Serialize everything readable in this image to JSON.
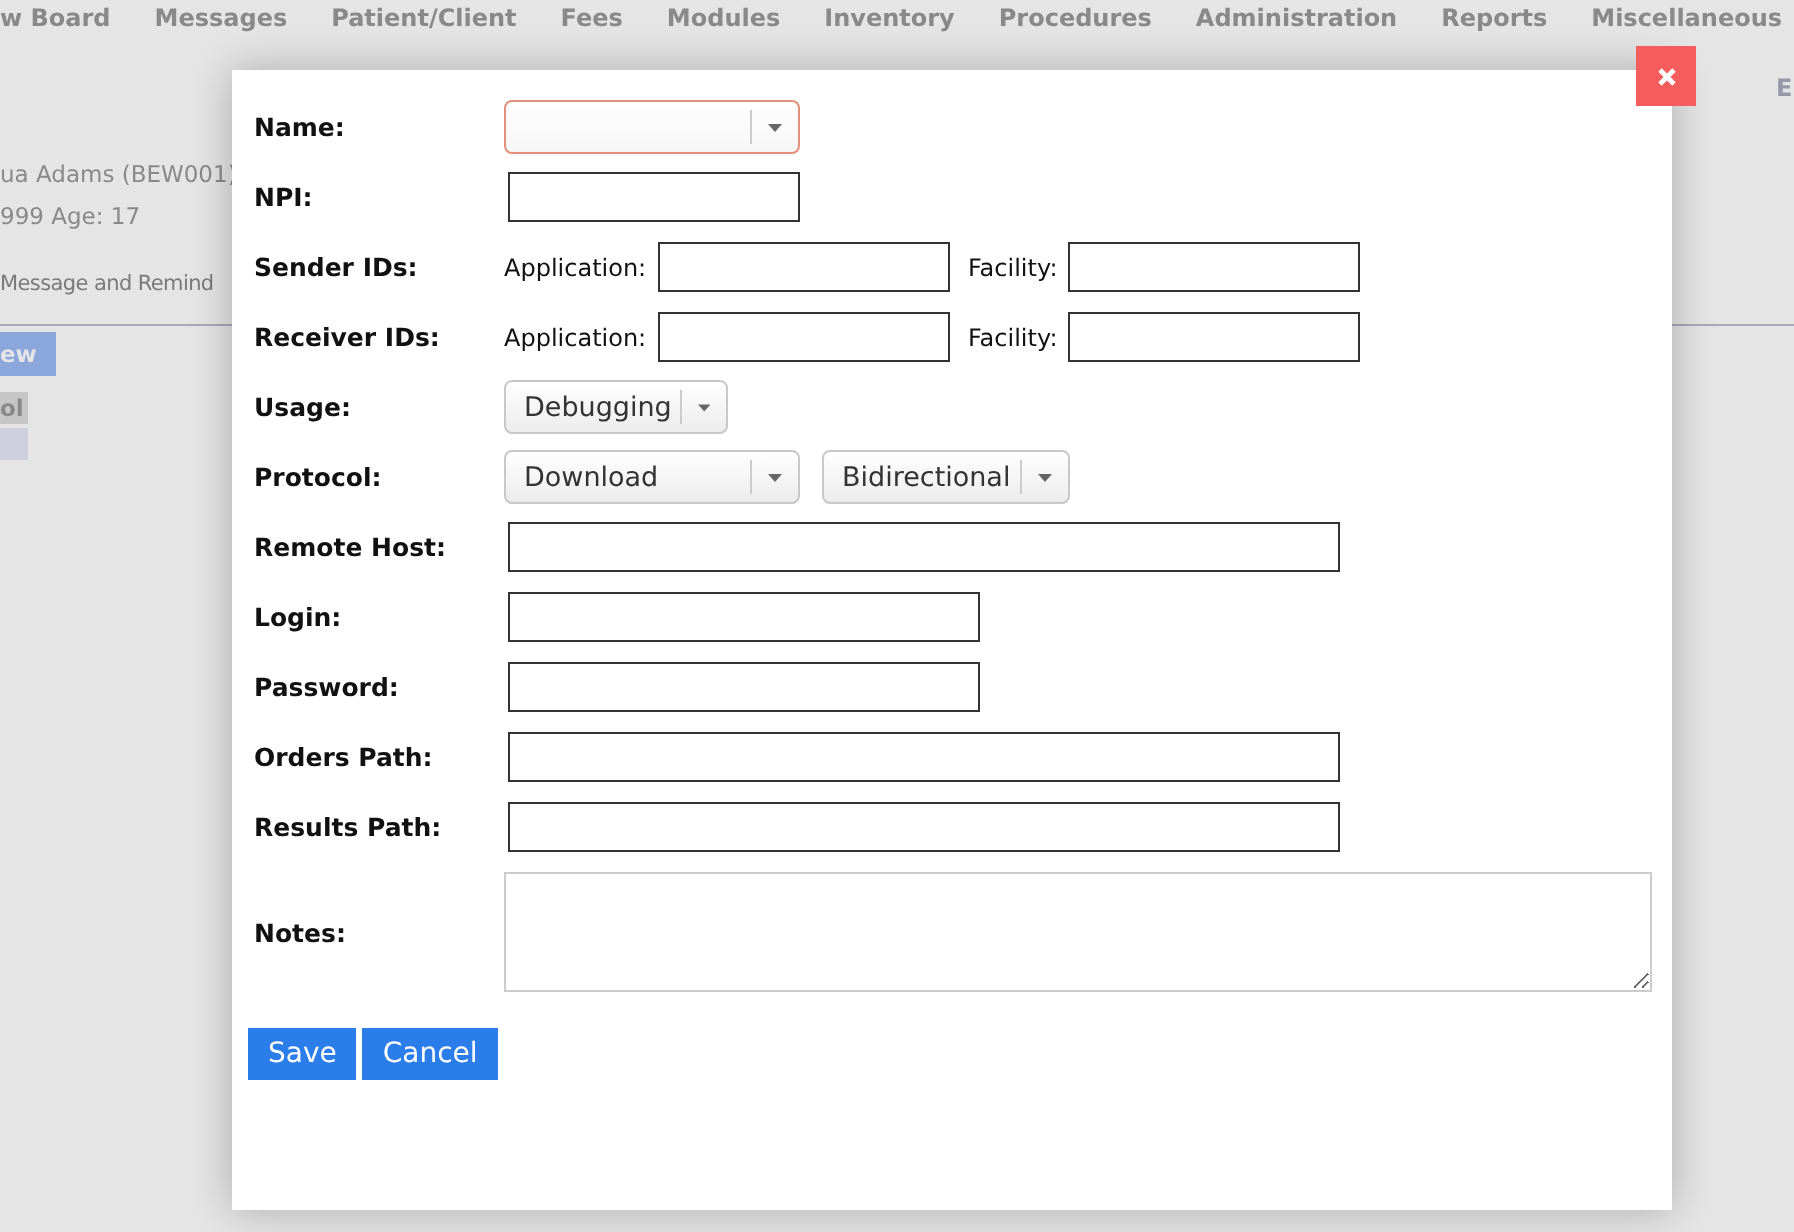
{
  "nav": [
    "w Board",
    "Messages",
    "Patient/Client",
    "Fees",
    "Modules",
    "Inventory",
    "Procedures",
    "Administration",
    "Reports",
    "Miscellaneous"
  ],
  "patient": {
    "name": "ua Adams (BEW001)",
    "details": "999 Age: 17",
    "link": "Message and Remind",
    "button": "ew",
    "cell": "ol",
    "corner": "E"
  },
  "dialog": {
    "fields": [
      {
        "kind": "select",
        "label": "Name:",
        "invalid": true
      },
      {
        "kind": "input",
        "label": "NPI:"
      },
      {
        "kind": "id-pair",
        "label": "Sender IDs:",
        "application_label": "Application:",
        "facility_label": "Facility:"
      },
      {
        "kind": "id-pair",
        "label": "Receiver IDs:",
        "application_label": "Application:",
        "facility_label": "Facility:"
      },
      {
        "kind": "select",
        "label": "Usage:",
        "value": "Debugging",
        "invalid": false
      },
      {
        "kind": "select-pair",
        "label": "Protocol:",
        "values": [
          "Download",
          "Bidirectional"
        ]
      },
      {
        "kind": "input",
        "label": "Remote Host:"
      },
      {
        "kind": "input",
        "label": "Login:"
      },
      {
        "kind": "input",
        "label": "Password:"
      },
      {
        "kind": "input",
        "label": "Orders Path:"
      },
      {
        "kind": "input",
        "label": "Results Path:"
      },
      {
        "kind": "textarea",
        "label": "Notes:"
      }
    ],
    "buttons": [
      "Save",
      "Cancel"
    ]
  }
}
